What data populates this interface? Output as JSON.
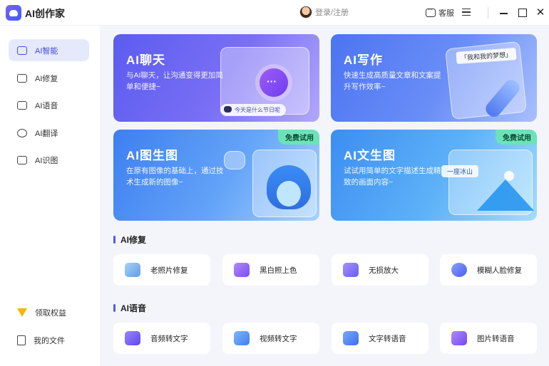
{
  "app": {
    "title": "AI创作家"
  },
  "header": {
    "login_text": "登录/注册",
    "service_label": "客服"
  },
  "sidebar": {
    "items": [
      {
        "label": "AI智能",
        "icon": "chat-bot-icon",
        "active": true
      },
      {
        "label": "AI修复",
        "icon": "repair-icon",
        "active": false
      },
      {
        "label": "AI语音",
        "icon": "voice-icon",
        "active": false
      },
      {
        "label": "AI翻译",
        "icon": "translate-icon",
        "active": false
      },
      {
        "label": "AI识图",
        "icon": "image-recognition-icon",
        "active": false
      }
    ],
    "bottom": [
      {
        "label": "领取权益",
        "icon": "gift-icon"
      },
      {
        "label": "我的文件",
        "icon": "file-icon"
      }
    ]
  },
  "cards": [
    {
      "title": "AI聊天",
      "desc": "与AI聊天，让沟通变得更加简单和便捷~",
      "pill": "今天是什么节日呢"
    },
    {
      "title": "AI写作",
      "desc": "快速生成高质量文章和文案提升写作效率~",
      "tag": "「我和我的梦想」"
    },
    {
      "title": "AI图生图",
      "desc": "在原有图像的基础上，通过技术生成新的图像~",
      "badge": "免费试用"
    },
    {
      "title": "AI文生图",
      "desc": "试试用简单的文字描述生成精致的画面内容~",
      "badge": "免费试用",
      "tag": "一座冰山"
    }
  ],
  "sections": [
    {
      "title": "AI修复",
      "tools": [
        {
          "label": "老照片修复",
          "icon": "old-photo-icon",
          "color": "#6aa8e8"
        },
        {
          "label": "黑白照上色",
          "icon": "colorize-icon",
          "color": "#8a63f5"
        },
        {
          "label": "无损放大",
          "icon": "enlarge-icon",
          "color": "#7b6cf6"
        },
        {
          "label": "模糊人脸修复",
          "icon": "face-repair-icon",
          "color": "#5a6ff0"
        }
      ]
    },
    {
      "title": "AI语音",
      "tools": [
        {
          "label": "音频转文字",
          "icon": "audio-to-text-icon",
          "color": "#6f5cf2"
        },
        {
          "label": "视频转文字",
          "icon": "video-to-text-icon",
          "color": "#4b8ef5"
        },
        {
          "label": "文字转语音",
          "icon": "text-to-speech-icon",
          "color": "#4a7ff2"
        },
        {
          "label": "图片转语音",
          "icon": "image-to-speech-icon",
          "color": "#7d5cf5"
        }
      ]
    }
  ]
}
